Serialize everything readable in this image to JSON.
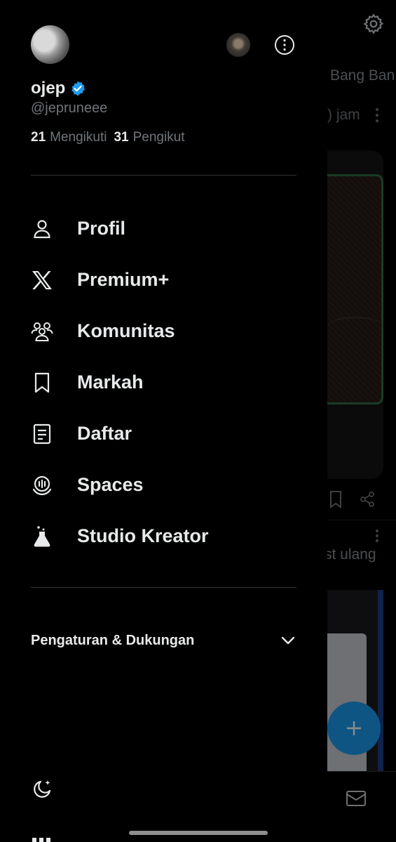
{
  "feed": {
    "tab_label": "Bang Ban",
    "time_label": ") jam",
    "repost_label": "st ulang"
  },
  "profile": {
    "name": "ojep",
    "handle": "@jepruneee",
    "following_count": "21",
    "following_label": "Mengikuti",
    "followers_count": "31",
    "followers_label": "Pengikut"
  },
  "menu": {
    "items": [
      {
        "label": "Profil",
        "icon": "person-icon"
      },
      {
        "label": "Premium+",
        "icon": "x-logo-icon"
      },
      {
        "label": "Komunitas",
        "icon": "communities-icon"
      },
      {
        "label": "Markah",
        "icon": "bookmark-icon"
      },
      {
        "label": "Daftar",
        "icon": "list-icon"
      },
      {
        "label": "Spaces",
        "icon": "spaces-icon"
      },
      {
        "label": "Studio Kreator",
        "icon": "flask-icon"
      }
    ]
  },
  "settings": {
    "label": "Pengaturan & Dukungan"
  },
  "colors": {
    "background": "#000000",
    "text_primary": "#e7e9ea",
    "text_secondary": "#71767b",
    "accent": "#1d9bf0",
    "divider": "#2f3336"
  }
}
